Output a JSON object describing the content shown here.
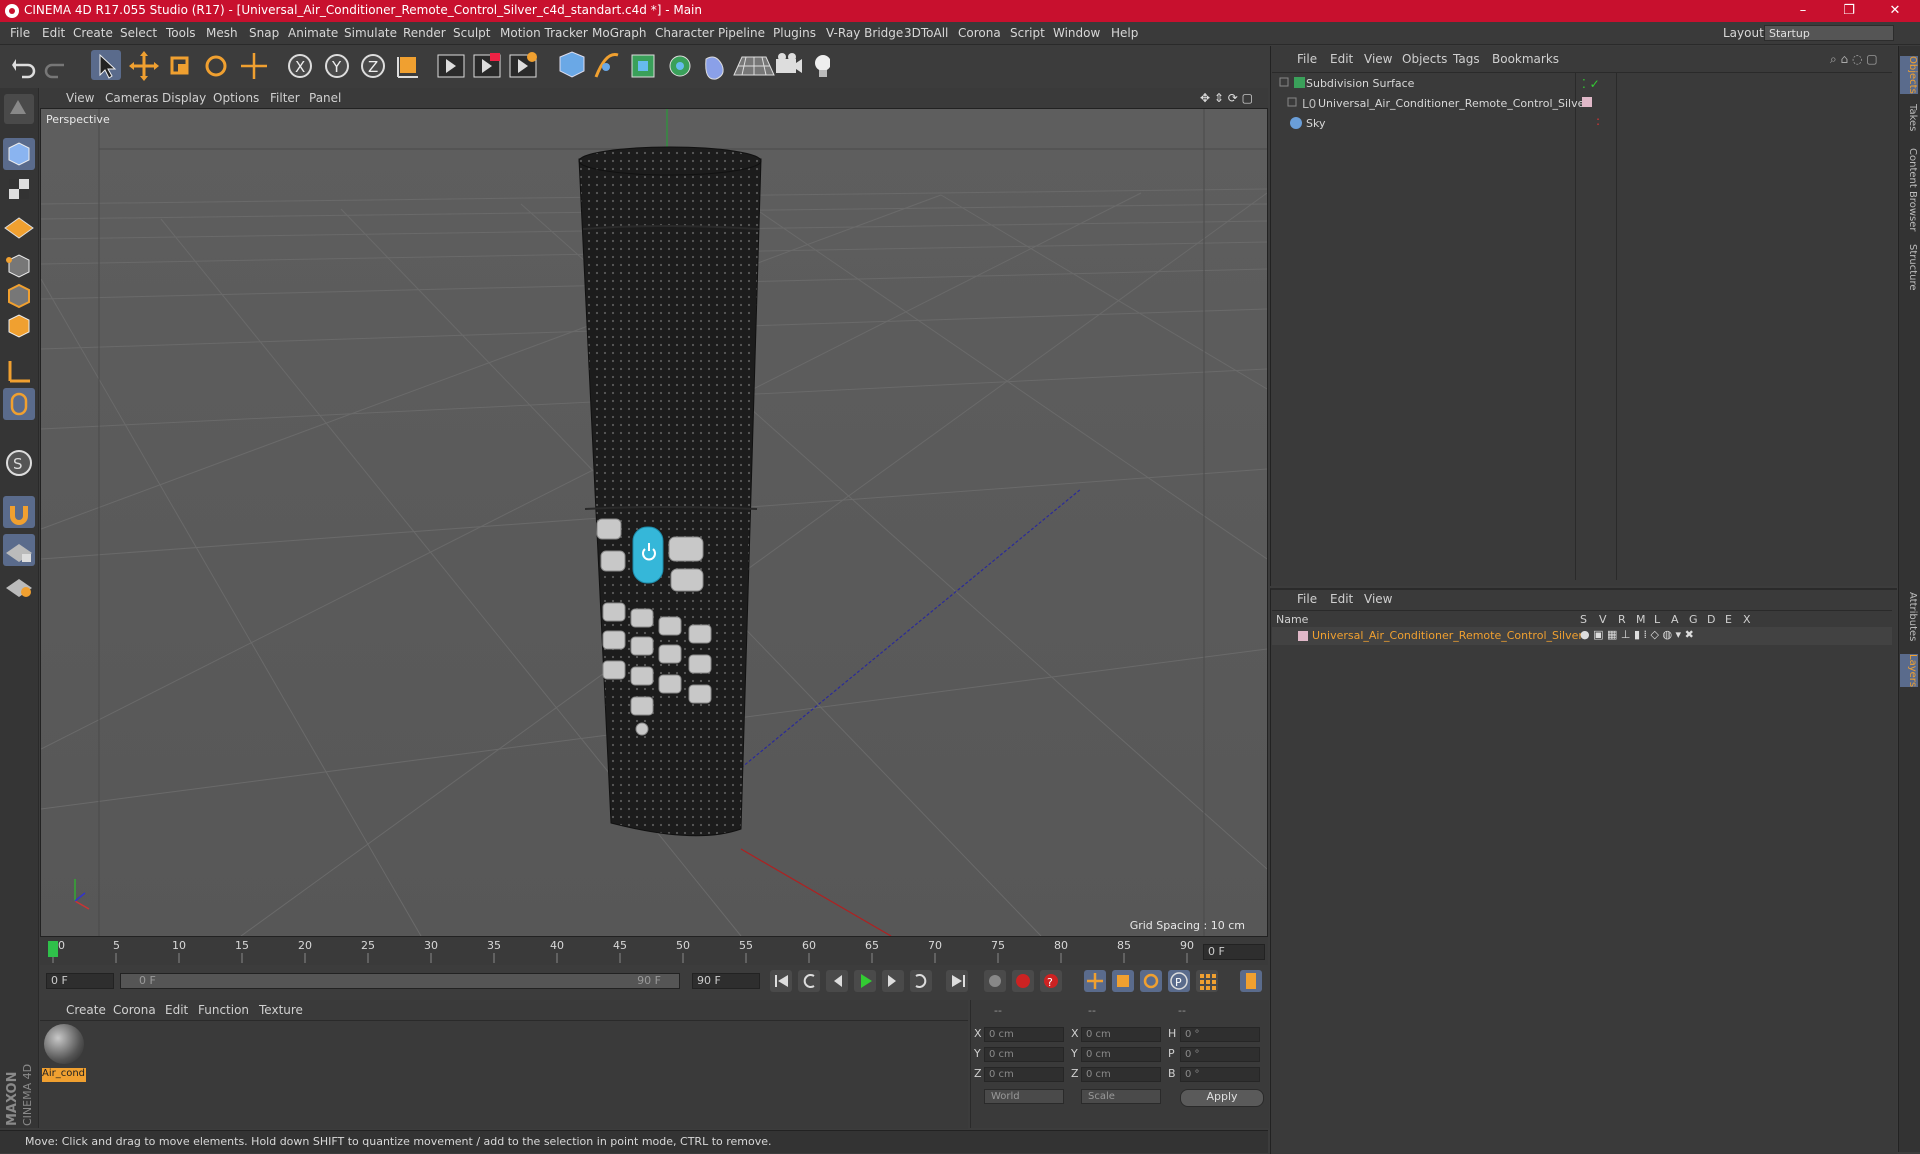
{
  "window": {
    "title": "CINEMA 4D R17.055 Studio (R17) - [Universal_Air_Conditioner_Remote_Control_Silver_c4d_standart.c4d *] - Main",
    "minimize": "–",
    "maximize": "❐",
    "close": "✕"
  },
  "menubar": {
    "items": [
      "File",
      "Edit",
      "Create",
      "Select",
      "Tools",
      "Mesh",
      "Snap",
      "Animate",
      "Simulate",
      "Render",
      "Sculpt",
      "Motion Tracker",
      "MoGraph",
      "Character",
      "Pipeline",
      "Plugins",
      "V-Ray Bridge",
      "3DToAll",
      "Corona",
      "Script",
      "Window",
      "Help"
    ],
    "layout_label": "Layout:",
    "layout_value": "Startup"
  },
  "viewport": {
    "menu": [
      "View",
      "Cameras",
      "Display",
      "Options",
      "Filter",
      "Panel"
    ],
    "label": "Perspective",
    "grid_spacing": "Grid Spacing : 10 cm"
  },
  "timeline": {
    "ticks": [
      "0",
      "5",
      "10",
      "15",
      "20",
      "25",
      "30",
      "35",
      "40",
      "45",
      "50",
      "55",
      "60",
      "65",
      "70",
      "75",
      "80",
      "85",
      "90"
    ],
    "current": "0 F",
    "start": "0 F",
    "range_start": "0 F",
    "range_end": "90 F",
    "end": "90 F"
  },
  "material_manager": {
    "menu": [
      "Create",
      "Corona",
      "Edit",
      "Function",
      "Texture"
    ],
    "material_name": "Air_cond"
  },
  "coordinates": {
    "header": [
      "--",
      "--",
      "--"
    ],
    "rows": [
      {
        "a": "X",
        "av": "0 cm",
        "b": "X",
        "bv": "0 cm",
        "c": "H",
        "cv": "0 °"
      },
      {
        "a": "Y",
        "av": "0 cm",
        "b": "Y",
        "bv": "0 cm",
        "c": "P",
        "cv": "0 °"
      },
      {
        "a": "Z",
        "av": "0 cm",
        "b": "Z",
        "bv": "0 cm",
        "c": "B",
        "cv": "0 °"
      }
    ],
    "mode": "World",
    "scale": "Scale",
    "apply": "Apply"
  },
  "status": "Move: Click and drag to move elements. Hold down SHIFT to quantize movement / add to the selection in point mode, CTRL to remove.",
  "object_manager": {
    "menu": [
      "File",
      "Edit",
      "View",
      "Objects",
      "Tags",
      "Bookmarks"
    ],
    "objects": [
      "Subdivision Surface",
      "Universal_Air_Conditioner_Remote_Control_Silver",
      "Sky"
    ]
  },
  "layer_manager": {
    "menu": [
      "File",
      "Edit",
      "View"
    ],
    "columns": [
      "Name",
      "S",
      "V",
      "R",
      "M",
      "L",
      "A",
      "G",
      "D",
      "E",
      "X"
    ],
    "layer": "Universal_Air_Conditioner_Remote_Control_Silver"
  },
  "side_tabs": [
    "Objects",
    "Takes",
    "Content Browser",
    "Structure",
    "Attributes",
    "Layers"
  ],
  "brand": "MAXON CINEMA 4D",
  "colors": {
    "titlebar": "#c8102e",
    "accent_orange": "#f0a030",
    "selected_blue": "#5a6b8c"
  }
}
